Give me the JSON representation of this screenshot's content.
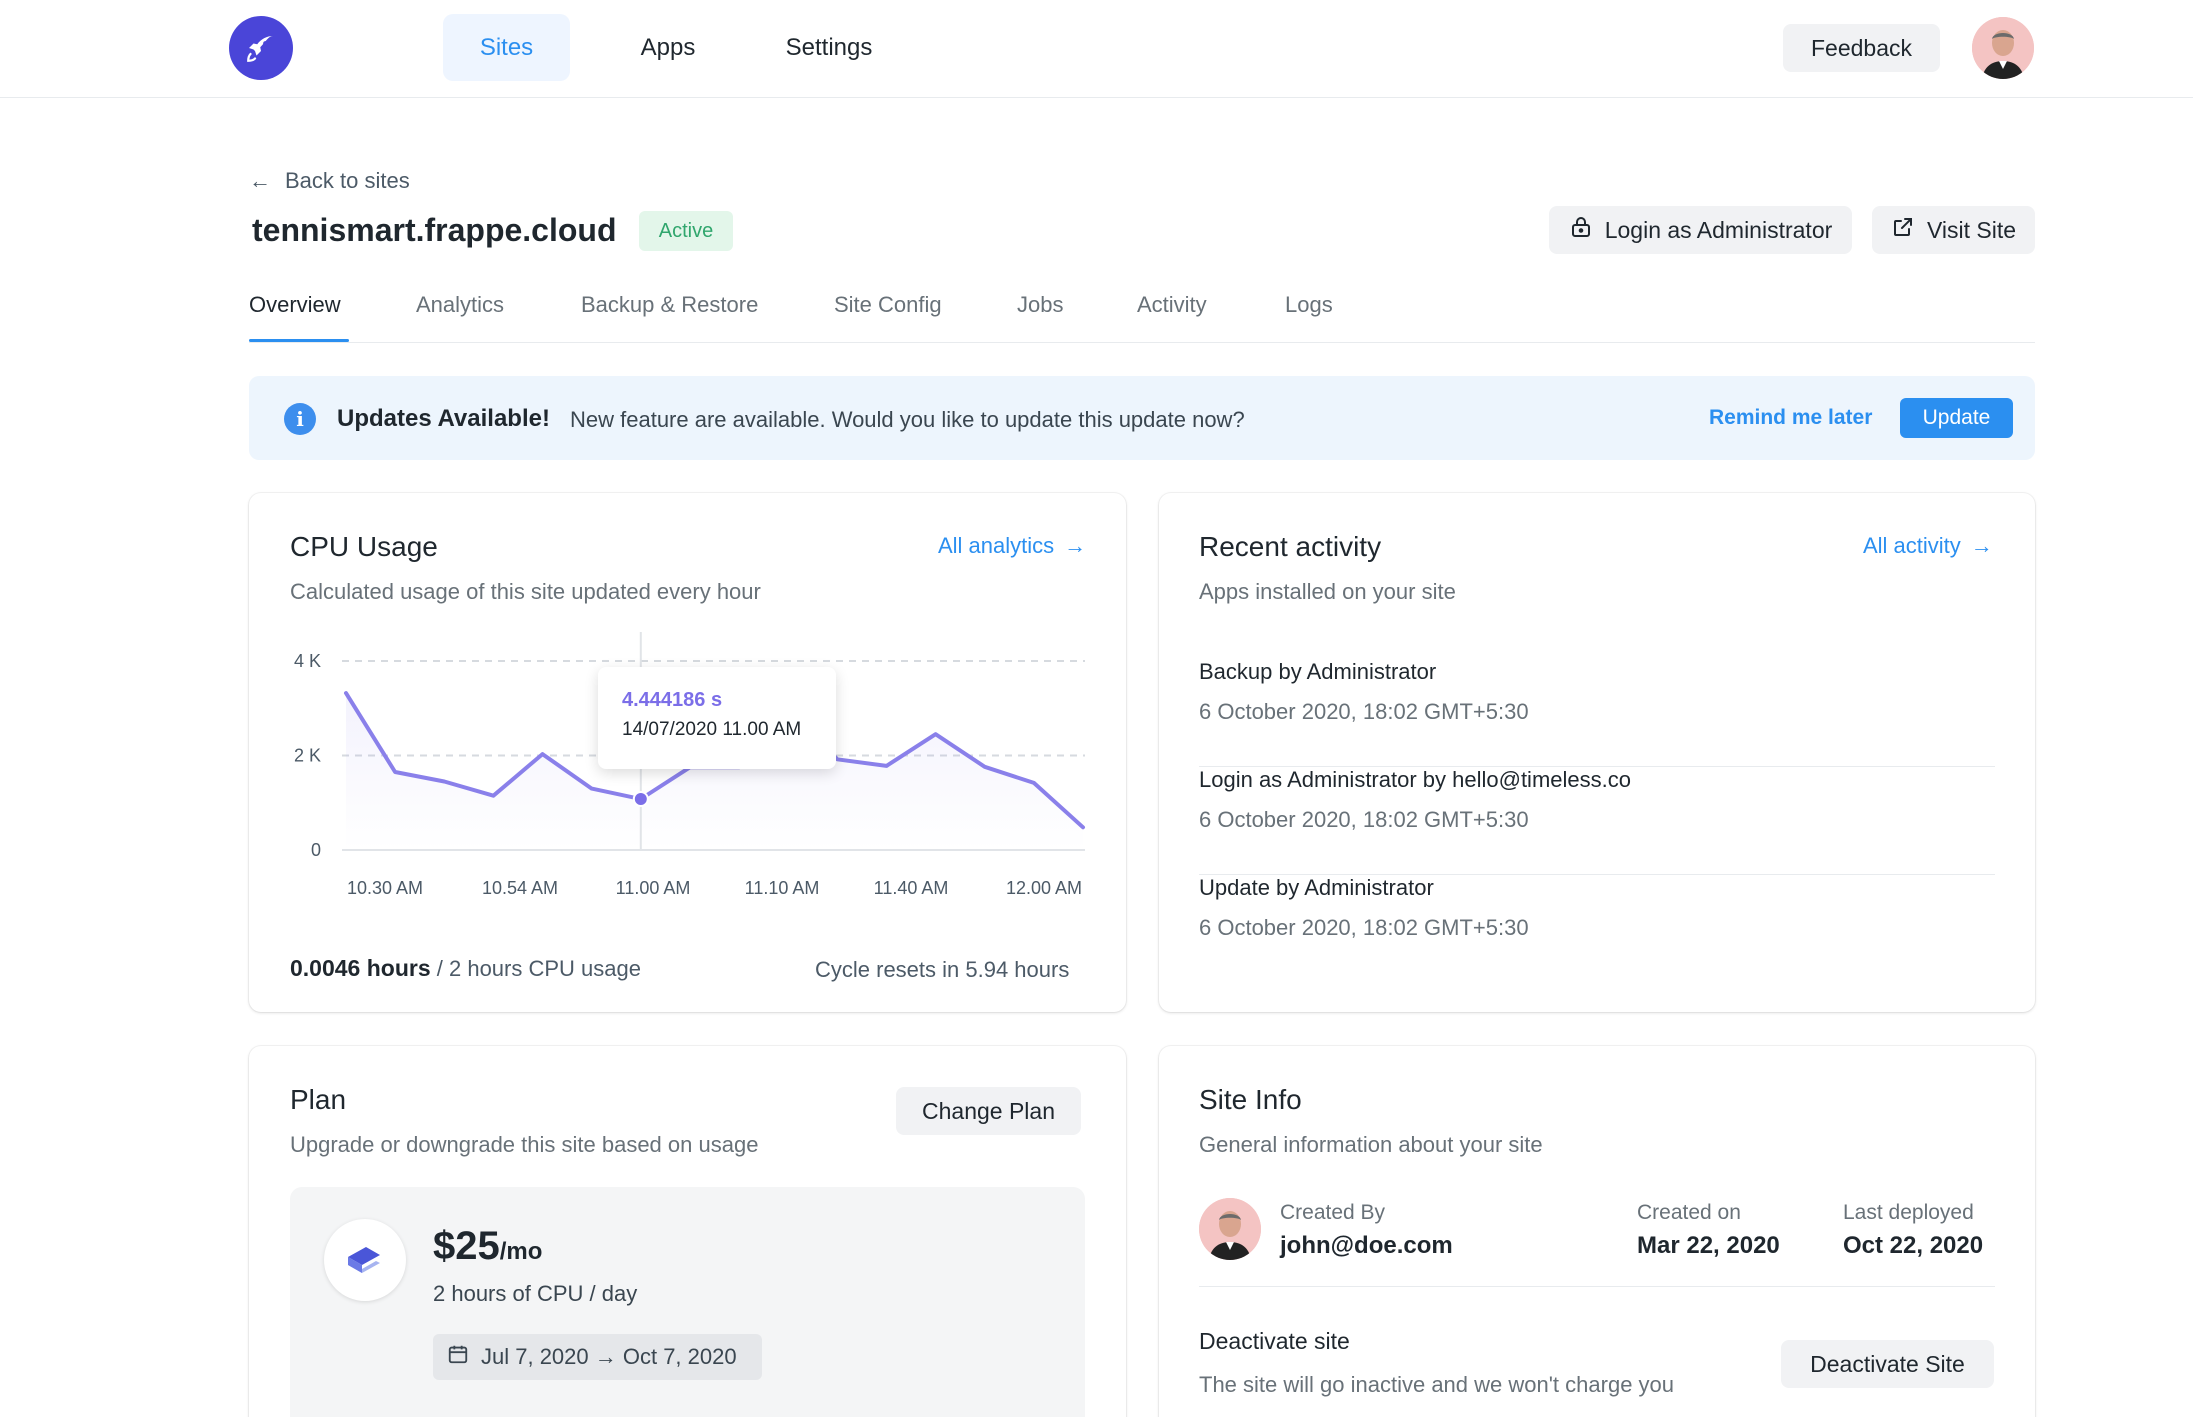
{
  "nav": {
    "logo_icon": "rocket-icon",
    "items": [
      {
        "label": "Sites",
        "active": true
      },
      {
        "label": "Apps",
        "active": false
      },
      {
        "label": "Settings",
        "active": false
      }
    ],
    "feedback_label": "Feedback"
  },
  "header": {
    "back_label": "Back to sites",
    "site_name": "tennismart.frappe.cloud",
    "status": "Active",
    "login_admin_label": "Login as Administrator",
    "visit_site_label": "Visit Site"
  },
  "tabs": [
    {
      "label": "Overview",
      "active": true
    },
    {
      "label": "Analytics"
    },
    {
      "label": "Backup & Restore"
    },
    {
      "label": "Site Config"
    },
    {
      "label": "Jobs"
    },
    {
      "label": "Activity"
    },
    {
      "label": "Logs"
    }
  ],
  "alert": {
    "title": "Updates Available!",
    "message": "New feature are available. Would you like to update this update now?",
    "remind_label": "Remind me later",
    "update_label": "Update"
  },
  "cpu": {
    "title": "CPU Usage",
    "subtitle": "Calculated usage of this site updated every hour",
    "link_label": "All analytics",
    "used": "0.0046 hours",
    "quota": "/ 2 hours CPU usage",
    "reset": "Cycle resets in 5.94 hours",
    "tooltip_value": "4.444186 s",
    "tooltip_time": "14/07/2020 11.00 AM"
  },
  "chart_data": {
    "type": "line",
    "title": "CPU Usage",
    "x_tick_labels": [
      "10.30 AM",
      "10.54 AM",
      "11.00 AM",
      "11.10 AM",
      "11.40 AM",
      "12.00 AM"
    ],
    "y_tick_labels": [
      "0",
      "2 K",
      "4 K"
    ],
    "ylim": [
      0,
      4000
    ],
    "series": [
      {
        "color": "#8a80ea",
        "values": [
          3320,
          1650,
          1450,
          1150,
          2030,
          1300,
          1080,
          1750,
          1750,
          3000,
          1920,
          1780,
          2450,
          1760,
          1420,
          480
        ]
      }
    ],
    "highlight_index": 6,
    "grid": "dashed horizontal at 2 K and 4 K",
    "legend": "none"
  },
  "activity": {
    "title": "Recent activity",
    "subtitle": "Apps installed on your site",
    "link_label": "All activity",
    "items": [
      {
        "title": "Backup by Administrator",
        "time": "6 October 2020, 18:02 GMT+5:30"
      },
      {
        "title": "Login as Administrator by hello@timeless.co",
        "time": "6 October 2020, 18:02 GMT+5:30"
      },
      {
        "title": "Update by Administrator",
        "time": "6 October 2020, 18:02 GMT+5:30"
      }
    ]
  },
  "plan": {
    "title": "Plan",
    "subtitle": "Upgrade or downgrade this site based on usage",
    "change_label": "Change Plan",
    "price": "$25",
    "period": "/mo",
    "description": "2 hours of CPU / day",
    "dates": "Jul 7, 2020 → Oct 7, 2020"
  },
  "site_info": {
    "title": "Site Info",
    "subtitle": "General information about your site",
    "created_by_label": "Created By",
    "created_by": "john@doe.com",
    "created_on_label": "Created on",
    "created_on": "Mar 22, 2020",
    "deployed_label": "Last deployed",
    "deployed": "Oct 22, 2020",
    "deactivate_title": "Deactivate site",
    "deactivate_desc": "The site will go inactive and we won't charge you",
    "deactivate_label": "Deactivate Site"
  },
  "colors": {
    "accent": "#2b8ff0",
    "logo": "#4a45d8",
    "chart_line": "#8a80ea",
    "active_badge_bg": "#e3f6ea",
    "active_badge_text": "#30a66d"
  }
}
